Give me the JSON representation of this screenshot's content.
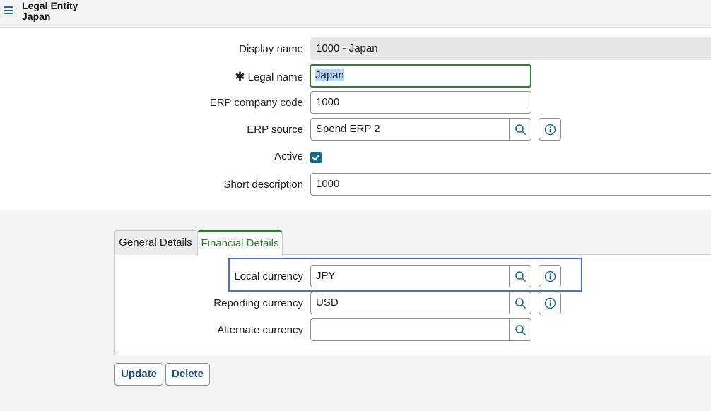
{
  "header": {
    "title_line1": "Legal Entity",
    "title_line2": "Japan"
  },
  "form": {
    "display_name": {
      "label": "Display name",
      "value": "1000 - Japan"
    },
    "legal_name": {
      "label": "Legal name",
      "required_mark": "✱",
      "value": "Japan"
    },
    "erp_company_code": {
      "label": "ERP company code",
      "value": "1000"
    },
    "erp_source": {
      "label": "ERP source",
      "value": "Spend ERP 2"
    },
    "active": {
      "label": "Active",
      "checked": true
    },
    "short_description": {
      "label": "Short description",
      "value": "1000"
    }
  },
  "tabs": [
    {
      "label": "General Details",
      "active": false
    },
    {
      "label": "Financial Details",
      "active": true
    }
  ],
  "financial": {
    "local_currency": {
      "label": "Local currency",
      "value": "JPY"
    },
    "reporting_currency": {
      "label": "Reporting currency",
      "value": "USD"
    },
    "alternate_currency": {
      "label": "Alternate currency",
      "value": ""
    }
  },
  "buttons": {
    "update": "Update",
    "delete": "Delete"
  },
  "colors": {
    "accent_green": "#2e7d32",
    "checkbox_teal": "#0f6b8c",
    "highlight_blue": "#4a6ee0",
    "button_text": "#1f4e79"
  },
  "icons": [
    "menu-icon",
    "search-icon",
    "info-icon",
    "checkmark-icon"
  ]
}
